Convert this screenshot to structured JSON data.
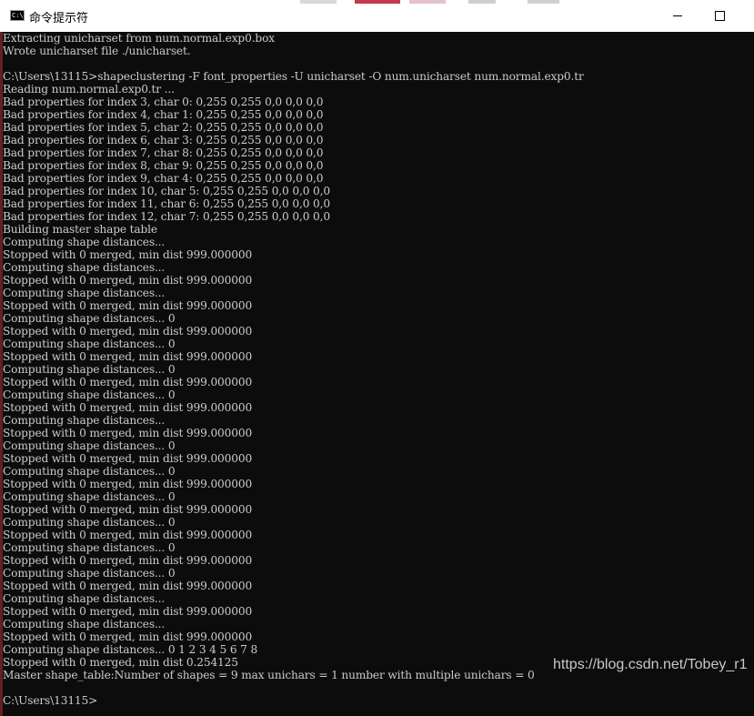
{
  "window": {
    "title": "命令提示符",
    "icon_name": "cmd-icon",
    "icon_text": "C:\\",
    "controls": [
      "minimize",
      "maximize"
    ]
  },
  "colors": {
    "console_bg": "#0c0c0c",
    "console_fg": "#cccccc",
    "titlebar_bg": "#ffffff",
    "left_accent": "#b03030"
  },
  "console": {
    "lines": [
      "Extracting unicharset from num.normal.exp0.box",
      "Wrote unicharset file ./unicharset.",
      "",
      "C:\\Users\\13115>shapeclustering -F font_properties -U unicharset -O num.unicharset num.normal.exp0.tr",
      "Reading num.normal.exp0.tr ...",
      "Bad properties for index 3, char 0: 0,255 0,255 0,0 0,0 0,0",
      "Bad properties for index 4, char 1: 0,255 0,255 0,0 0,0 0,0",
      "Bad properties for index 5, char 2: 0,255 0,255 0,0 0,0 0,0",
      "Bad properties for index 6, char 3: 0,255 0,255 0,0 0,0 0,0",
      "Bad properties for index 7, char 8: 0,255 0,255 0,0 0,0 0,0",
      "Bad properties for index 8, char 9: 0,255 0,255 0,0 0,0 0,0",
      "Bad properties for index 9, char 4: 0,255 0,255 0,0 0,0 0,0",
      "Bad properties for index 10, char 5: 0,255 0,255 0,0 0,0 0,0",
      "Bad properties for index 11, char 6: 0,255 0,255 0,0 0,0 0,0",
      "Bad properties for index 12, char 7: 0,255 0,255 0,0 0,0 0,0",
      "Building master shape table",
      "Computing shape distances...",
      "Stopped with 0 merged, min dist 999.000000",
      "Computing shape distances...",
      "Stopped with 0 merged, min dist 999.000000",
      "Computing shape distances...",
      "Stopped with 0 merged, min dist 999.000000",
      "Computing shape distances... 0",
      "Stopped with 0 merged, min dist 999.000000",
      "Computing shape distances... 0",
      "Stopped with 0 merged, min dist 999.000000",
      "Computing shape distances... 0",
      "Stopped with 0 merged, min dist 999.000000",
      "Computing shape distances... 0",
      "Stopped with 0 merged, min dist 999.000000",
      "Computing shape distances...",
      "Stopped with 0 merged, min dist 999.000000",
      "Computing shape distances... 0",
      "Stopped with 0 merged, min dist 999.000000",
      "Computing shape distances... 0",
      "Stopped with 0 merged, min dist 999.000000",
      "Computing shape distances... 0",
      "Stopped with 0 merged, min dist 999.000000",
      "Computing shape distances... 0",
      "Stopped with 0 merged, min dist 999.000000",
      "Computing shape distances... 0",
      "Stopped with 0 merged, min dist 999.000000",
      "Computing shape distances... 0",
      "Stopped with 0 merged, min dist 999.000000",
      "Computing shape distances...",
      "Stopped with 0 merged, min dist 999.000000",
      "Computing shape distances...",
      "Stopped with 0 merged, min dist 999.000000",
      "Computing shape distances... 0 1 2 3 4 5 6 7 8",
      "Stopped with 0 merged, min dist 0.254125",
      "Master shape_table:Number of shapes = 9 max unichars = 1 number with multiple unichars = 0",
      "",
      "C:\\Users\\13115>"
    ]
  },
  "watermark": "https://blog.csdn.net/Tobey_r1"
}
